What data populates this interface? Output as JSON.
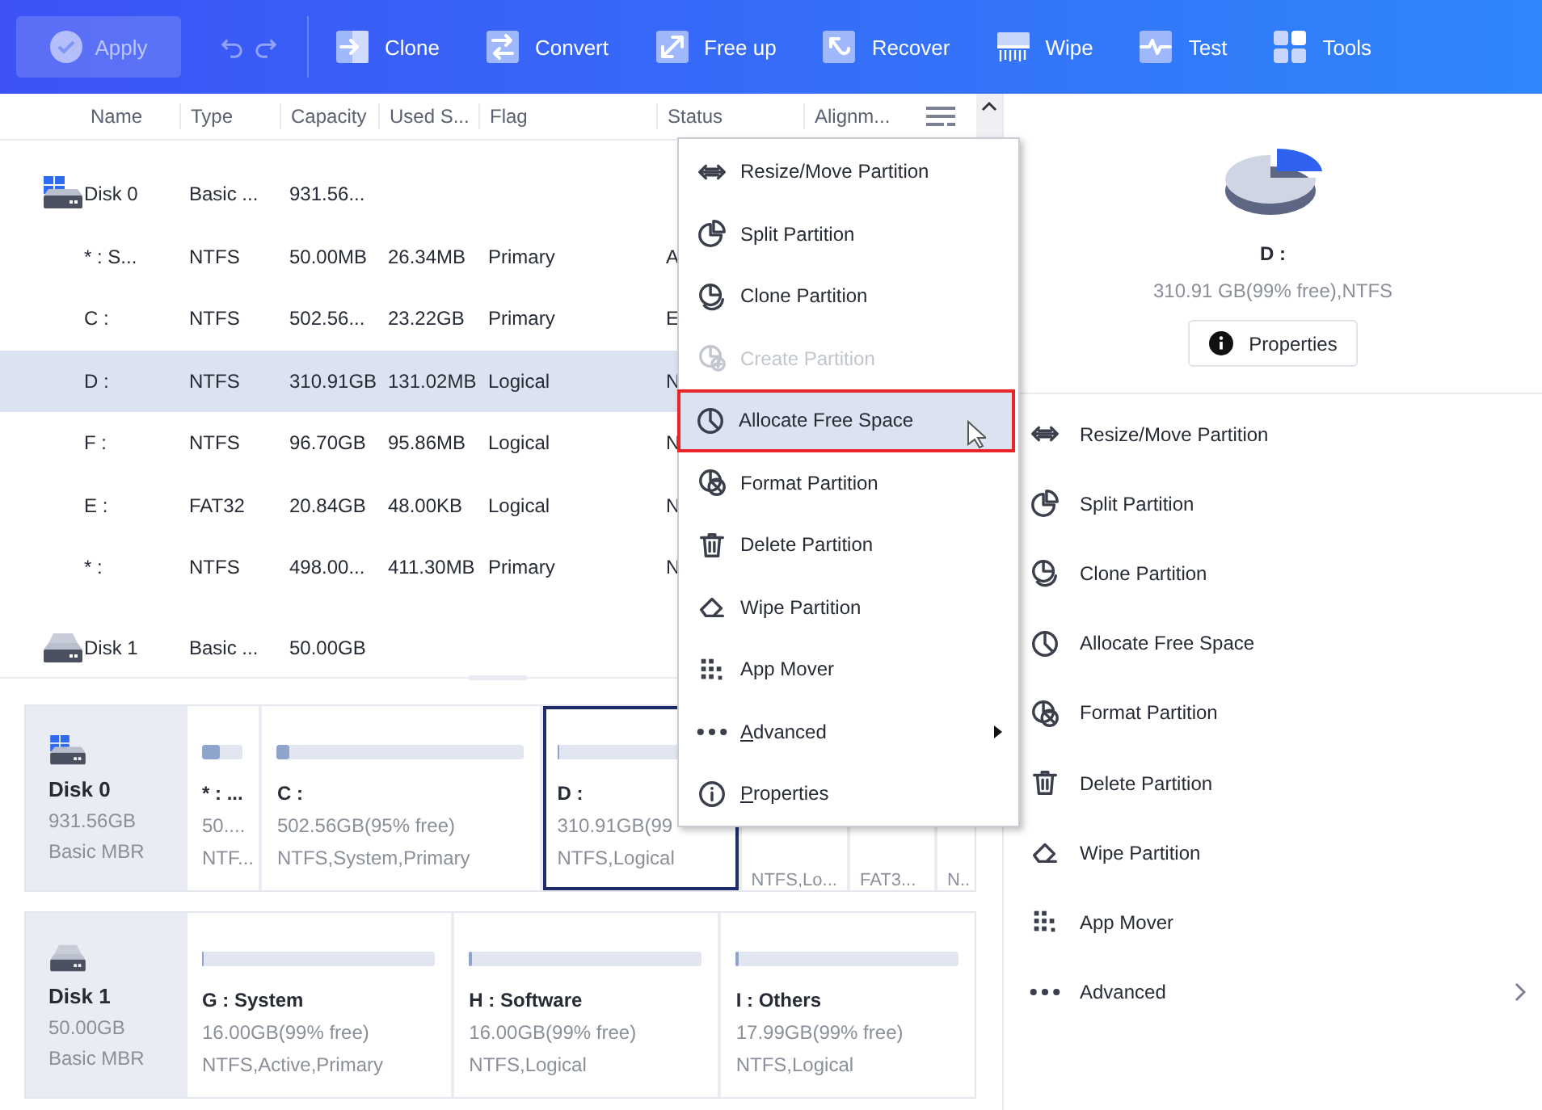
{
  "toolbar": {
    "apply": {
      "label": "Apply",
      "disabled": true
    },
    "undo": {
      "disabled": true
    },
    "redo": {
      "disabled": true
    },
    "tools": [
      {
        "label": "Clone",
        "kind": "clone"
      },
      {
        "label": "Convert",
        "kind": "convert"
      },
      {
        "label": "Free up",
        "kind": "freeup"
      },
      {
        "label": "Recover",
        "kind": "recover"
      },
      {
        "label": "Wipe",
        "kind": "wipe"
      },
      {
        "label": "Test",
        "kind": "test"
      },
      {
        "label": "Tools",
        "kind": "tools"
      }
    ]
  },
  "table": {
    "columns": [
      "Name",
      "Type",
      "Capacity",
      "Used S...",
      "Flag",
      "Status",
      "Alignm..."
    ],
    "rows": [
      {
        "kind": "disk",
        "system": true,
        "name": "Disk 0",
        "type": "Basic ...",
        "capacity": "931.56...",
        "selected": false
      },
      {
        "kind": "partition",
        "name": "* : S...",
        "type": "NTFS",
        "capacity": "50.00MB",
        "used": "26.34MB",
        "flag": "Primary",
        "status": "A",
        "selected": false
      },
      {
        "kind": "partition",
        "name": "C :",
        "type": "NTFS",
        "capacity": "502.56...",
        "used": "23.22GB",
        "flag": "Primary",
        "status": "E",
        "selected": false
      },
      {
        "kind": "partition",
        "name": "D :",
        "type": "NTFS",
        "capacity": "310.91GB",
        "used": "131.02MB",
        "flag": "Logical",
        "status": "N",
        "selected": true
      },
      {
        "kind": "partition",
        "name": "F :",
        "type": "NTFS",
        "capacity": "96.70GB",
        "used": "95.86MB",
        "flag": "Logical",
        "status": "N",
        "selected": false
      },
      {
        "kind": "partition",
        "name": "E :",
        "type": "FAT32",
        "capacity": "20.84GB",
        "used": "48.00KB",
        "flag": "Logical",
        "status": "N",
        "selected": false
      },
      {
        "kind": "partition",
        "name": "* :",
        "type": "NTFS",
        "capacity": "498.00...",
        "used": "411.30MB",
        "flag": "Primary",
        "status": "N",
        "selected": false
      },
      {
        "kind": "disk",
        "system": false,
        "name": "Disk 1",
        "type": "Basic ...",
        "capacity": "50.00GB",
        "selected": false
      }
    ]
  },
  "disk_map": [
    {
      "name": "Disk 0",
      "system": true,
      "size": "931.56GB",
      "style": "Basic MBR",
      "partitions": [
        {
          "name": "* : ...",
          "info": "50....",
          "fs": "NTF...",
          "level": 0.45,
          "selected": false
        },
        {
          "name": "C :",
          "info": "502.56GB(95% free)",
          "fs": "NTFS,System,Primary",
          "level": 0.05,
          "selected": false
        },
        {
          "name": "D :",
          "info": "310.91GB(99",
          "fs": "NTFS,Logical",
          "level": 0.01,
          "selected": true
        },
        {
          "fs": "NTFS,Lo...",
          "selected": false
        },
        {
          "fs": "FAT3...",
          "selected": false
        },
        {
          "fs": "N...",
          "selected": false
        }
      ]
    },
    {
      "name": "Disk 1",
      "system": false,
      "size": "50.00GB",
      "style": "Basic MBR",
      "partitions": [
        {
          "name": "G : System",
          "info": "16.00GB(99% free)",
          "fs": "NTFS,Active,Primary",
          "level": 0.01,
          "selected": false
        },
        {
          "name": "H : Software",
          "info": "16.00GB(99% free)",
          "fs": "NTFS,Logical",
          "level": 0.01,
          "selected": false
        },
        {
          "name": "I : Others",
          "info": "17.99GB(99% free)",
          "fs": "NTFS,Logical",
          "level": 0.01,
          "selected": false
        }
      ]
    }
  ],
  "details": {
    "title": "D :",
    "info": "310.91 GB(99% free),NTFS",
    "button": "Properties"
  },
  "actions": [
    {
      "label": "Resize/Move Partition",
      "kind": "resize",
      "submenu": false
    },
    {
      "label": "Split Partition",
      "kind": "split",
      "submenu": false
    },
    {
      "label": "Clone Partition",
      "kind": "clone",
      "submenu": false
    },
    {
      "label": "Allocate Free Space",
      "kind": "allocate",
      "submenu": false
    },
    {
      "label": "Format Partition",
      "kind": "format",
      "submenu": false
    },
    {
      "label": "Delete Partition",
      "kind": "delete",
      "submenu": false
    },
    {
      "label": "Wipe Partition",
      "kind": "wipe",
      "submenu": false
    },
    {
      "label": "App Mover",
      "kind": "appmover",
      "submenu": false
    },
    {
      "label": "Advanced",
      "kind": "advanced",
      "submenu": true
    }
  ],
  "context_menu": [
    {
      "label": "Resize/Move Partition",
      "kind": "resize",
      "disabled": false,
      "selected": false,
      "submenu": false,
      "mnemonic": false
    },
    {
      "label": "Split Partition",
      "kind": "split",
      "disabled": false,
      "selected": false,
      "submenu": false,
      "mnemonic": false
    },
    {
      "label": "Clone Partition",
      "kind": "clone",
      "disabled": false,
      "selected": false,
      "submenu": false,
      "mnemonic": false
    },
    {
      "label": "Create Partition",
      "kind": "create",
      "disabled": true,
      "selected": false,
      "submenu": false,
      "mnemonic": false
    },
    {
      "label": "Allocate Free Space",
      "kind": "allocate",
      "disabled": false,
      "selected": true,
      "submenu": false,
      "mnemonic": false
    },
    {
      "label": "Format Partition",
      "kind": "format",
      "disabled": false,
      "selected": false,
      "submenu": false,
      "mnemonic": false
    },
    {
      "label": "Delete Partition",
      "kind": "delete",
      "disabled": false,
      "selected": false,
      "submenu": false,
      "mnemonic": false
    },
    {
      "label": "Wipe Partition",
      "kind": "wipe",
      "disabled": false,
      "selected": false,
      "submenu": false,
      "mnemonic": false
    },
    {
      "label": "App Mover",
      "kind": "appmover",
      "disabled": false,
      "selected": false,
      "submenu": false,
      "mnemonic": false
    },
    {
      "label": "Advanced",
      "kind": "advanced",
      "disabled": false,
      "selected": false,
      "submenu": true,
      "mnemonic": true
    },
    {
      "label": "Properties",
      "kind": "properties",
      "disabled": false,
      "selected": false,
      "submenu": false,
      "mnemonic": true
    }
  ]
}
